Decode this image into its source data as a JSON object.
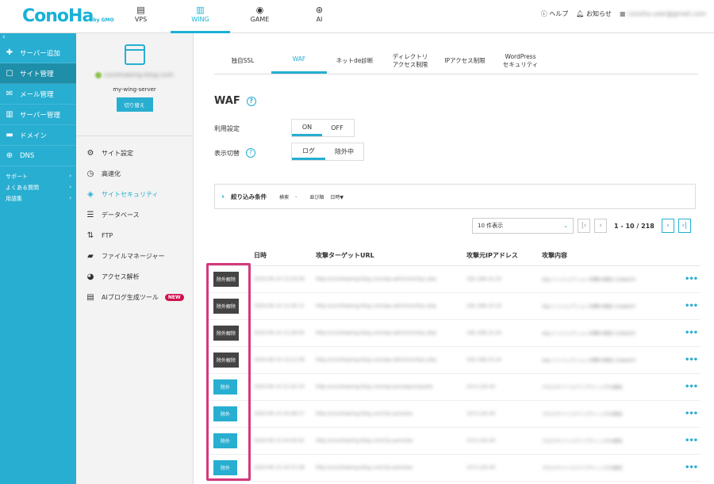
{
  "header": {
    "logo": "ConoHa",
    "logo_sub": "by GMO",
    "nav": [
      {
        "label": "VPS",
        "icon": "server-icon"
      },
      {
        "label": "WING",
        "icon": "wing-icon",
        "active": true
      },
      {
        "label": "GAME",
        "icon": "gamepad-icon"
      },
      {
        "label": "AI",
        "icon": "ai-chip-icon"
      }
    ],
    "help": "ヘルプ",
    "notifications": "お知らせ",
    "account": "conoha.user@gmail.com"
  },
  "sidebar": {
    "items": [
      {
        "label": "サーバー追加",
        "icon": "plus-icon"
      },
      {
        "label": "サイト管理",
        "icon": "site-icon",
        "active": true
      },
      {
        "label": "メール管理",
        "icon": "mail-icon"
      },
      {
        "label": "サーバー管理",
        "icon": "server-icon"
      },
      {
        "label": "ドメイン",
        "icon": "domain-icon"
      },
      {
        "label": "DNS",
        "icon": "globe-icon"
      }
    ],
    "sub": [
      {
        "label": "サポート"
      },
      {
        "label": "よくある質問"
      },
      {
        "label": "用語集"
      }
    ]
  },
  "panel": {
    "domain": "conohawing-blog.com",
    "server_name": "my-wing-server",
    "switch_label": "切り替え",
    "menu": [
      {
        "label": "サイト設定",
        "icon": "settings-icon"
      },
      {
        "label": "高速化",
        "icon": "stopwatch-icon"
      },
      {
        "label": "サイトセキュリティ",
        "icon": "shield-icon",
        "active": true
      },
      {
        "label": "データベース",
        "icon": "database-icon"
      },
      {
        "label": "FTP",
        "icon": "transfer-icon"
      },
      {
        "label": "ファイルマネージャー",
        "icon": "folder-icon"
      },
      {
        "label": "アクセス解析",
        "icon": "pie-chart-icon"
      },
      {
        "label": "AIブログ生成ツール",
        "icon": "document-icon",
        "badge": "NEW"
      }
    ]
  },
  "tabs": [
    {
      "label": "独自SSL"
    },
    {
      "label": "WAF",
      "active": true
    },
    {
      "label": "ネットde診断"
    },
    {
      "label": "ディレクトリ\nアクセス制限"
    },
    {
      "label": "IPアクセス制限"
    },
    {
      "label": "WordPress\nセキュリティ"
    }
  ],
  "waf": {
    "title": "WAF",
    "usage_label": "利用設定",
    "usage_on": "ON",
    "usage_off": "OFF",
    "view_label": "表示切替",
    "view_log": "ログ",
    "view_excluded": "除外中"
  },
  "filter": {
    "label": "絞り込み条件",
    "search_label": "検索",
    "search_value": "-",
    "sort_label": "並び順",
    "sort_value": "日時▼"
  },
  "pager": {
    "per_page": "10 件表示",
    "range": "1 - 10 / 218"
  },
  "table": {
    "columns": [
      "日時",
      "攻撃ターゲットURL",
      "攻撃元IPアドレス",
      "攻撃内容"
    ],
    "rows": [
      {
        "action": "除外解除",
        "type": "unexclude",
        "date": "2024-06-14 12:34:56",
        "url": "http://conohawing-blog.com/wp-admin/xmlrpc.php",
        "ip": "192.168.10.24",
        "attack": "SQLインジェクション攻撃の検知 (OWASP)"
      },
      {
        "action": "除外解除",
        "type": "unexclude",
        "date": "2024-06-14 12:30:11",
        "url": "http://conohawing-blog.com/wp-admin/xmlrpc.php",
        "ip": "192.168.10.24",
        "attack": "SQLインジェクション攻撃の検知 (OWASP)"
      },
      {
        "action": "除外解除",
        "type": "unexclude",
        "date": "2024-06-14 12:28:45",
        "url": "http://conohawing-blog.com/wp-admin/xmlrpc.php",
        "ip": "192.168.10.24",
        "attack": "SQLインジェクション攻撃の検知 (OWASP)"
      },
      {
        "action": "除外解除",
        "type": "unexclude",
        "date": "2024-06-14 12:21:09",
        "url": "http://conohawing-blog.com/wp-admin/xmlrpc.php",
        "ip": "192.168.10.24",
        "attack": "SQLインジェクション攻撃の検知 (OWASP)"
      },
      {
        "action": "除外",
        "type": "exclude",
        "date": "2024-06-13 21:02:33",
        "url": "http://conohawing-blog.com/wp-json/wp/v2/posts",
        "ip": "10.0.120.45",
        "attack": "クロスサイトスクリプティングの検知"
      },
      {
        "action": "除外",
        "type": "exclude",
        "date": "2024-06-13 20:48:17",
        "url": "http://conohawing-blog.com/?p=preview",
        "ip": "10.0.120.45",
        "attack": "クロスサイトスクリプティングの検知"
      },
      {
        "action": "除外",
        "type": "exclude",
        "date": "2024-06-13 20:40:02",
        "url": "http://conohawing-blog.com/?p=preview",
        "ip": "10.0.120.45",
        "attack": "クロスサイトスクリプティングの検知"
      },
      {
        "action": "除外",
        "type": "exclude",
        "date": "2024-06-13 20:31:58",
        "url": "http://conohawing-blog.com/?p=preview",
        "ip": "10.0.120.45",
        "attack": "クロスサイトスクリプティングの検知"
      }
    ]
  },
  "colors": {
    "accent": "#27aed1",
    "dark_button": "#444444",
    "highlight": "#d43a7c",
    "badge": "#d0104c"
  }
}
